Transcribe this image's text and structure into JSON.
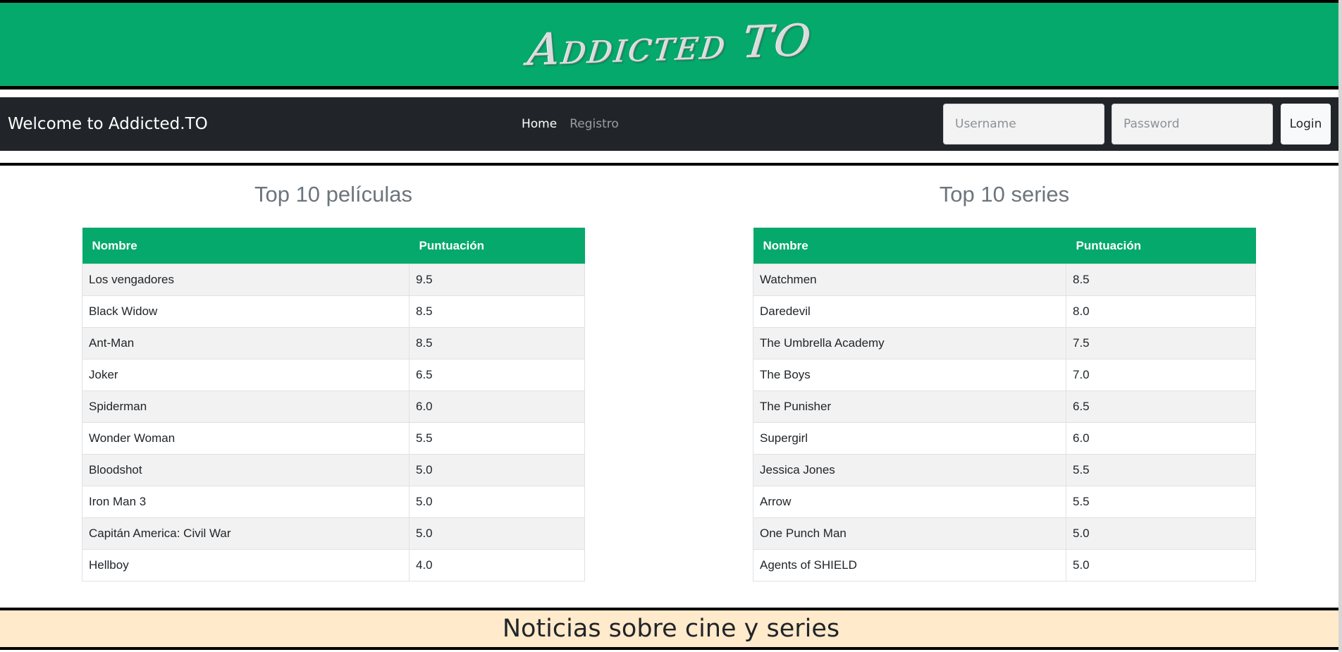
{
  "header": {
    "logo_text": "Addicted TO",
    "bg_color": "#05a96b"
  },
  "navbar": {
    "brand": "Welcome to Addicted.TO",
    "links": [
      {
        "label": "Home",
        "active": true
      },
      {
        "label": "Registro",
        "active": false
      }
    ],
    "username_placeholder": "Username",
    "password_placeholder": "Password",
    "login_label": "Login",
    "bg_color": "#212529"
  },
  "movies": {
    "title": "Top 10 películas",
    "columns": [
      "Nombre",
      "Puntuación"
    ],
    "rows": [
      [
        "Los vengadores",
        "9.5"
      ],
      [
        "Black Widow",
        "8.5"
      ],
      [
        "Ant-Man",
        "8.5"
      ],
      [
        "Joker",
        "6.5"
      ],
      [
        "Spiderman",
        "6.0"
      ],
      [
        "Wonder Woman",
        "5.5"
      ],
      [
        "Bloodshot",
        "5.0"
      ],
      [
        "Iron Man 3",
        "5.0"
      ],
      [
        "Capitán America: Civil War",
        "5.0"
      ],
      [
        "Hellboy",
        "4.0"
      ]
    ]
  },
  "series": {
    "title": "Top 10 series",
    "columns": [
      "Nombre",
      "Puntuación"
    ],
    "rows": [
      [
        "Watchmen",
        "8.5"
      ],
      [
        "Daredevil",
        "8.0"
      ],
      [
        "The Umbrella Academy",
        "7.5"
      ],
      [
        "The Boys",
        "7.0"
      ],
      [
        "The Punisher",
        "6.5"
      ],
      [
        "Supergirl",
        "6.0"
      ],
      [
        "Jessica Jones",
        "5.5"
      ],
      [
        "Arrow",
        "5.5"
      ],
      [
        "One Punch Man",
        "5.0"
      ],
      [
        "Agents of SHIELD",
        "5.0"
      ]
    ]
  },
  "news": {
    "title": "Noticias sobre cine y series",
    "bg_color": "#ffeacb"
  }
}
